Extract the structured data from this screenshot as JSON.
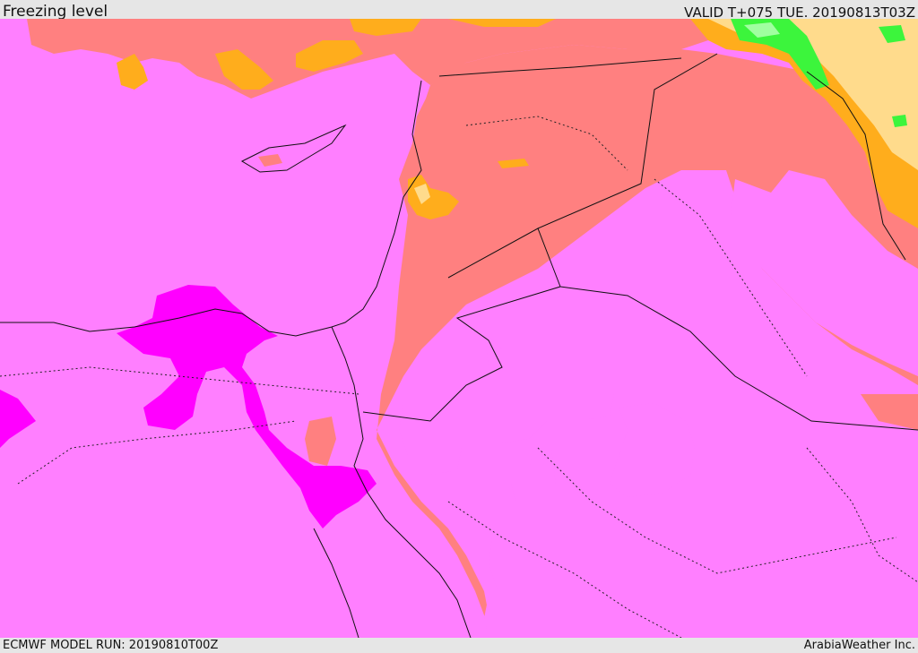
{
  "header": {
    "title": "Freezing level",
    "valid_time": "VALID T+075 TUE. 20190813T03Z"
  },
  "footer": {
    "model_run": "ECMWF MODEL RUN: 20190810T00Z",
    "credit": "ArabiaWeather Inc."
  },
  "colors": {
    "band_base": "#ff7fff",
    "band_low": "#ff00ff",
    "band_mid": "#ff8080",
    "band_high": "#ffad1c",
    "band_higher": "#ffdb8c",
    "band_top": "#3cf53c",
    "band_peak": "#a0ffa0",
    "boundary_line": "#111111"
  }
}
